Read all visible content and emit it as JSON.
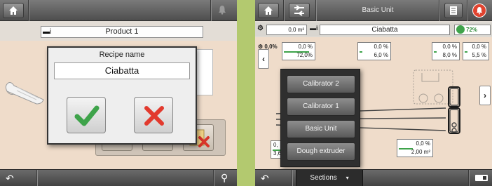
{
  "left": {
    "topbar": {
      "home_icon": "home-icon",
      "bell_icon": "bell-icon"
    },
    "product_bar": {
      "label": "Product 1"
    },
    "dialog": {
      "title": "Recipe name",
      "value": "Ciabatta",
      "ok_icon": "checkmark-icon",
      "cancel_icon": "cross-icon",
      "ok_color": "#3ea34a",
      "cancel_color": "#e23a2e"
    },
    "bottombar": {
      "back_icon": "back-arrow-icon",
      "usb_icon": "usb-icon"
    }
  },
  "right": {
    "topbar": {
      "title": "Basic Unit",
      "home_icon": "home-icon",
      "machine_icon": "machine-icon",
      "notes_icon": "notes-icon",
      "alarm_icon": "alarm-icon"
    },
    "row2": {
      "speed_value": "0,0 m²",
      "recipe_value": "Ciabatta",
      "gauge_value": "72%"
    },
    "values": {
      "corner": "0,0%",
      "b1_top": "0,0 %",
      "b1_bot": "72,0%",
      "b2_top": "0,0 %",
      "b2_bot": "6,0 %",
      "b3_top": "0,0 %",
      "b3_bot": "8,0 %",
      "b4_top": "0,0 %",
      "b4_bot": "5,5 %",
      "bl_top": "0,",
      "bl_bot": "3,60",
      "bc_top": "0,0 %",
      "bc_bot": "2,00 m²"
    },
    "menu": {
      "items": [
        "Calibrator 2",
        "Calibrator 1",
        "Basic Unit",
        "Dough extruder"
      ]
    },
    "bottombar": {
      "sections_label": "Sections",
      "back_icon": "back-arrow-icon",
      "battery_icon": "battery-icon"
    }
  }
}
